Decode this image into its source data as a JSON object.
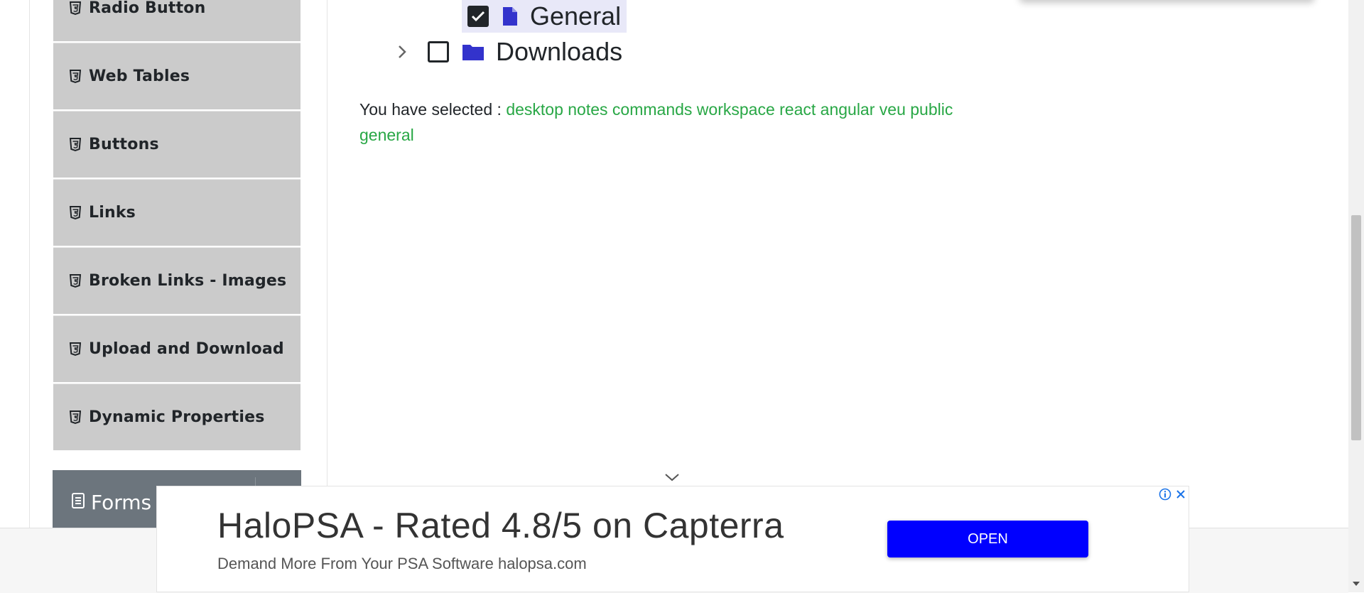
{
  "sidebar": {
    "items": [
      {
        "label": "Radio Button"
      },
      {
        "label": "Web Tables"
      },
      {
        "label": "Buttons"
      },
      {
        "label": "Links"
      },
      {
        "label": "Broken Links - Images"
      },
      {
        "label": "Upload and Download"
      },
      {
        "label": "Dynamic Properties"
      }
    ],
    "next_group": {
      "label": "Forms"
    }
  },
  "tree": {
    "general": {
      "label": "General",
      "checked": true
    },
    "downloads": {
      "label": "Downloads",
      "checked": false
    }
  },
  "result": {
    "prefix": "You have selected :",
    "words": [
      "desktop",
      "notes",
      "commands",
      "workspace",
      "react",
      "angular",
      "veu",
      "public",
      "general"
    ]
  },
  "ad": {
    "title": "HaloPSA - Rated 4.8/5 on Capterra",
    "subtitle": "Demand More From Your PSA Software halopsa.com",
    "button": "OPEN"
  },
  "colors": {
    "selected_words": "#28a745",
    "ad_button": "#0000ff",
    "folder_icon": "#3333cc"
  }
}
